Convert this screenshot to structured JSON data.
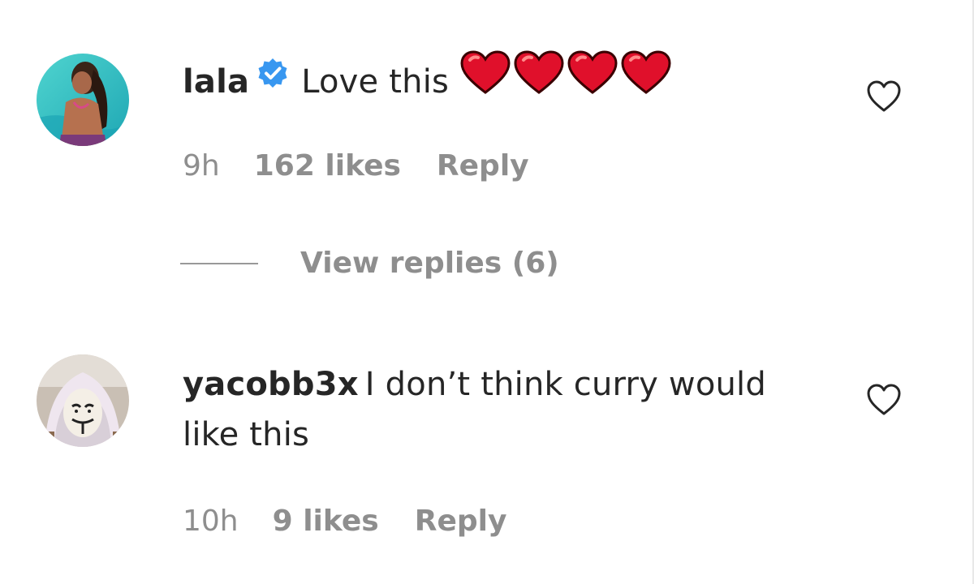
{
  "comments": [
    {
      "username": "lala",
      "verified": true,
      "text": "Love this",
      "emoji": [
        "red-heart",
        "red-heart",
        "red-heart",
        "red-heart"
      ],
      "time": "9h",
      "likes": "162 likes",
      "reply_label": "Reply",
      "view_replies_label": "View replies (6)"
    },
    {
      "username": "yacobb3x",
      "verified": false,
      "text": "I don’t think curry would like this",
      "time": "10h",
      "likes": "9 likes",
      "reply_label": "Reply"
    }
  ],
  "colors": {
    "text": "#262626",
    "meta": "#8e8e8e",
    "verified": "#3897f0",
    "heart": "#e0102b"
  }
}
